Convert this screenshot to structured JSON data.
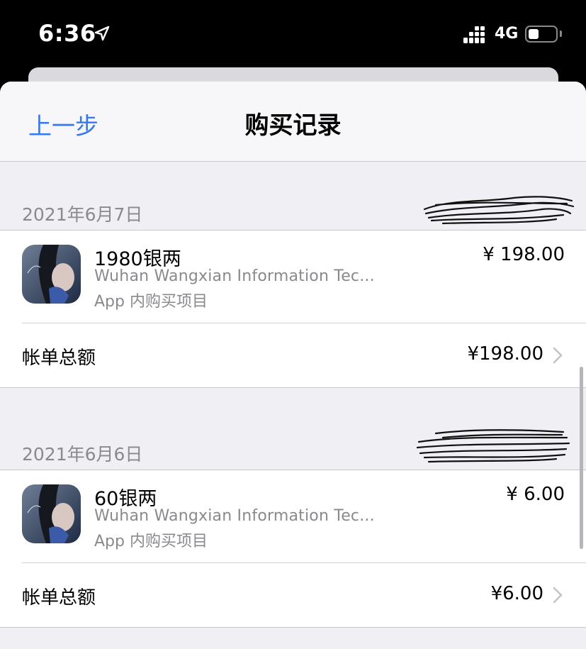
{
  "status_bar": {
    "time": "6:36",
    "network": "4G",
    "battery_level": 0.4
  },
  "nav": {
    "back_label": "上一步",
    "title": "购买记录"
  },
  "colors": {
    "accent": "#3478f6",
    "secondary_text": "#8a8a8e",
    "background": "#efeff4"
  },
  "sections": [
    {
      "date": "2021年6月7日",
      "item": {
        "name": "1980银两",
        "developer": "Wuhan Wangxian Information Tec...",
        "type": "App 内购买项目",
        "price": "¥ 198.00"
      },
      "total_label": "帐单总额",
      "total_amount": "¥198.00"
    },
    {
      "date": "2021年6月6日",
      "item": {
        "name": "60银两",
        "developer": "Wuhan Wangxian Information Tec...",
        "type": "App 内购买项目",
        "price": "¥ 6.00"
      },
      "total_label": "帐单总额",
      "total_amount": "¥6.00"
    }
  ]
}
